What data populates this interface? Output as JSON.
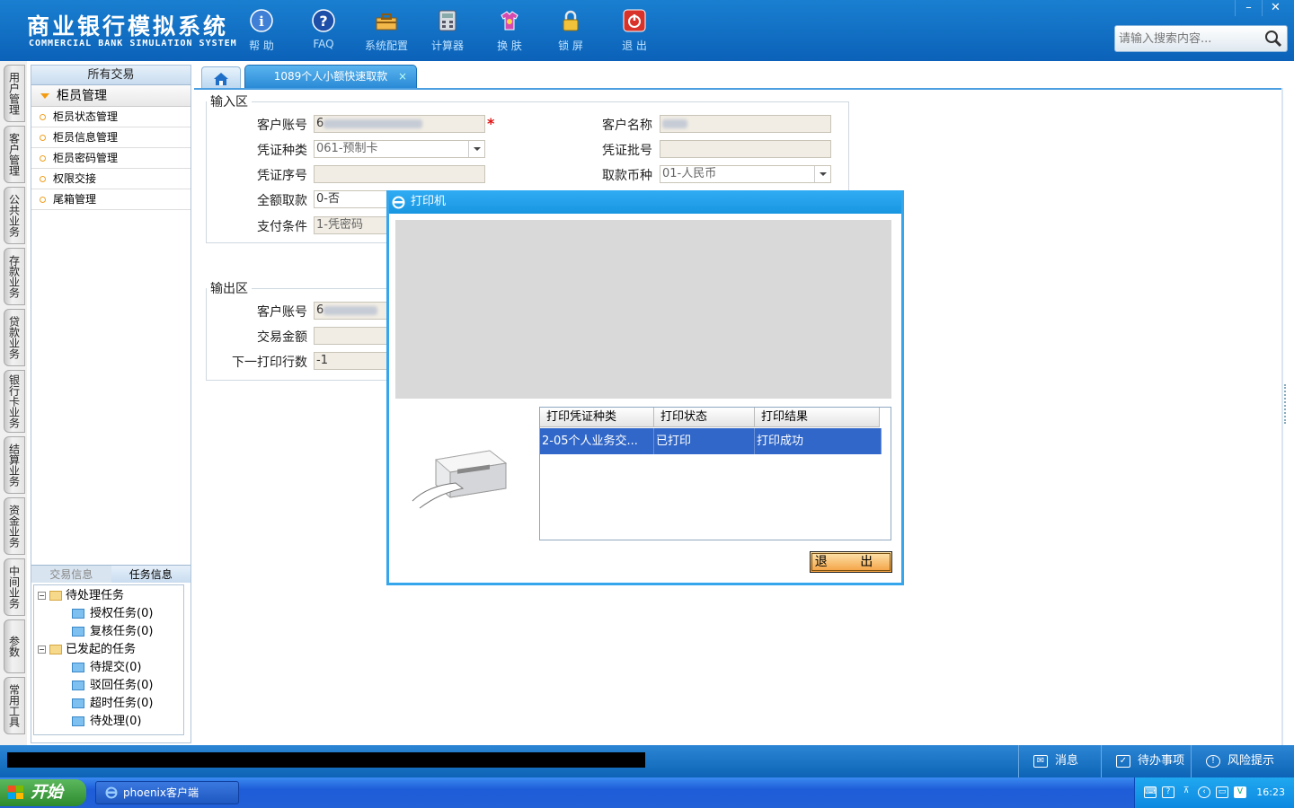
{
  "header": {
    "title_cn": "商业银行模拟系统",
    "title_en": "COMMERCIAL BANK SIMULATION SYSTEM",
    "toolbar": [
      {
        "label": "帮 助",
        "icon": "info-icon"
      },
      {
        "label": "FAQ",
        "icon": "question-icon"
      },
      {
        "label": "系统配置",
        "icon": "settings-toolbox-icon"
      },
      {
        "label": "计算器",
        "icon": "calculator-icon"
      },
      {
        "label": "换 肤",
        "icon": "skin-shirt-icon"
      },
      {
        "label": "锁 屏",
        "icon": "lock-icon"
      },
      {
        "label": "退 出",
        "icon": "power-icon"
      }
    ],
    "window_controls": {
      "minimize": "–",
      "close": "✕"
    },
    "search_placeholder": "请输入搜索内容..."
  },
  "vertical_tabs": [
    "用户管理",
    "客户管理",
    "公共业务",
    "存款业务",
    "贷款业务",
    "银行卡业务",
    "结算业务",
    "资金业务",
    "中间业务",
    "参数",
    "常用工具"
  ],
  "sidebar": {
    "header": "所有交易",
    "group": "柜员管理",
    "items": [
      "柜员状态管理",
      "柜员信息管理",
      "柜员密码管理",
      "权限交接",
      "尾箱管理"
    ],
    "tabs": [
      "交易信息",
      "任务信息"
    ],
    "tree": {
      "pending": "待处理任务",
      "auth": "授权任务(0)",
      "review": "复核任务(0)",
      "initiated": "已发起的任务",
      "to_submit": "待提交(0)",
      "rejected": "驳回任务(0)",
      "timeout": "超时任务(0)",
      "to_handle": "待处理(0)"
    }
  },
  "tabs": {
    "active": "1089个人小额快速取款",
    "close": "×"
  },
  "input_area": {
    "legend": "输入区",
    "fields": {
      "account_label": "客户账号",
      "account_value": "6",
      "name_label": "客户名称",
      "voucher_type_label": "凭证种类",
      "voucher_type_value": "061-预制卡",
      "voucher_batch_label": "凭证批号",
      "voucher_seq_label": "凭证序号",
      "currency_label": "取款币种",
      "currency_value": "01-人民币",
      "full_withdraw_label": "全额取款",
      "full_withdraw_value": "0-否",
      "pay_cond_label": "支付条件",
      "pay_cond_value": "1-凭密码"
    },
    "required_mark": "*"
  },
  "output_area": {
    "legend": "输出区",
    "fields": {
      "account_label": "客户账号",
      "account_value": "6",
      "amount_label": "交易金额",
      "next_line_label": "下一打印行数",
      "next_line_value": "-1"
    }
  },
  "printer_dialog": {
    "title": "打印机",
    "columns": [
      "打印凭证种类",
      "打印状态",
      "打印结果"
    ],
    "rows": [
      {
        "type": "2-05个人业务交...",
        "status": "已打印",
        "result": "打印成功"
      }
    ],
    "exit_button": "退 出"
  },
  "statusbar": {
    "messages": "消息",
    "todo": "待办事项",
    "risk": "风险提示"
  },
  "taskbar": {
    "start": "开始",
    "app": "phoenix客户端",
    "clock": "16:23"
  },
  "colors": {
    "header_bg": "#0b62b8",
    "dialog_title": "#1896e0",
    "selected_row": "#3167c8",
    "exit_button": "#f4a040"
  }
}
